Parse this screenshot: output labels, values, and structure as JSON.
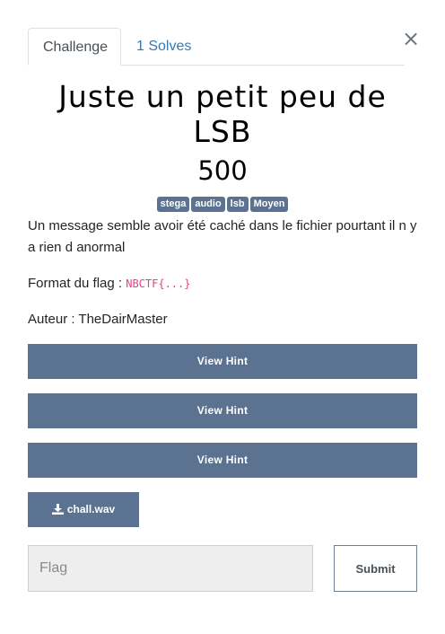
{
  "modal": {
    "close_glyph": "×",
    "tabs": [
      {
        "label": "Challenge",
        "active": true
      },
      {
        "label": "1 Solves",
        "active": false
      }
    ]
  },
  "challenge": {
    "title": "Juste un petit peu de LSB",
    "value": "500",
    "tags": [
      "stega",
      "audio",
      "lsb",
      "Moyen"
    ],
    "description": "Un message semble avoir été caché dans le fichier pourtant il n y a rien d anormal",
    "flag_format_label": "Format du flag : ",
    "flag_format_code": "NBCTF{...}",
    "author_line": "Auteur : TheDairMaster"
  },
  "hints": [
    {
      "label": "View Hint"
    },
    {
      "label": "View Hint"
    },
    {
      "label": "View Hint"
    }
  ],
  "file": {
    "name": "chall.wav",
    "icon": "download-icon"
  },
  "submission": {
    "placeholder": "Flag",
    "value": "",
    "submit_label": "Submit"
  },
  "colors": {
    "accent": "#5b7290",
    "link": "#337ab7",
    "code": "#e83e8c"
  }
}
